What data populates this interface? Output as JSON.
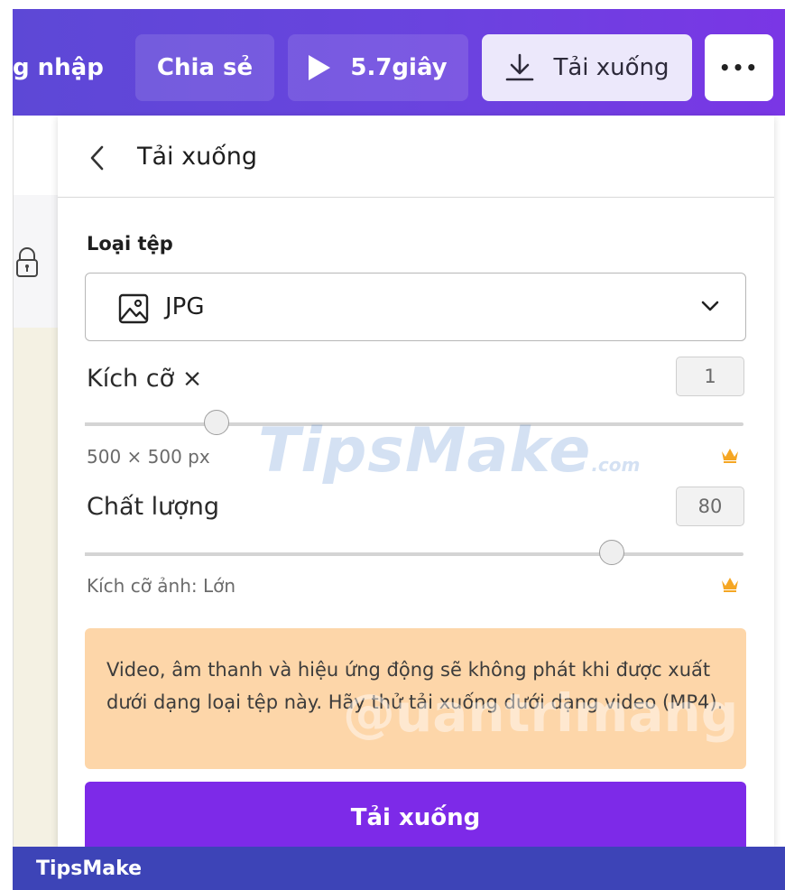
{
  "topbar": {
    "login_label": "g nhập",
    "share_label": "Chia sẻ",
    "play_label": "5.7giây",
    "download_label": "Tải xuống",
    "more_label": "•••",
    "color": "#6a43df"
  },
  "panel": {
    "title": "Tải xuống",
    "file_type_label": "Loại tệp",
    "file_type_value": "JPG",
    "size_label": "Kích cỡ ×",
    "size_value": "1",
    "size_slider_level": 0.2,
    "size_dimensions": "500 × 500 px",
    "quality_label": "Chất lượng",
    "quality_value": "80",
    "quality_slider_level": 0.8,
    "image_size_label": "Kích cỡ ảnh: Lớn",
    "notice_text": "Video, âm thanh và hiệu ứng động sẽ không phát khi được xuất dưới dạng loại tệp này. Hãy thử tải xuống dưới dạng video (MP4).",
    "download_button": "Tải xuống",
    "accent": "#7d2ae8",
    "notice_color": "#fdd6a9",
    "crown_color": "#f5a623"
  },
  "icons": {
    "back": "chevron-left-icon",
    "file_image": "image-icon",
    "dropdown": "chevron-down-icon",
    "premium": "crown-icon",
    "lock": "lock-icon",
    "download": "download-icon",
    "play": "play-icon"
  },
  "watermarks": {
    "tipsmake": "TipsMake",
    "tipsmake_suffix": ".com",
    "quantrimang": "@uantrimang"
  },
  "footer": {
    "brand": "TipsMake"
  }
}
